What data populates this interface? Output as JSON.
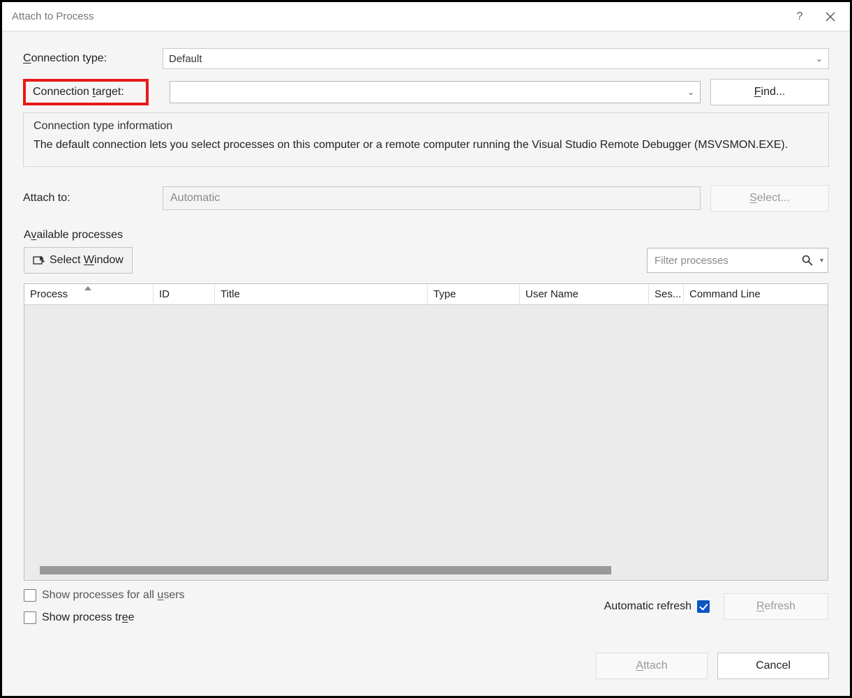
{
  "window": {
    "title": "Attach to Process"
  },
  "labels": {
    "connection_type": "Connection type:",
    "connection_target": "Connection target:",
    "attach_to": "Attach to:",
    "available_processes": "Available processes"
  },
  "fields": {
    "connection_type_value": "Default",
    "connection_target_value": "",
    "attach_to_value": "Automatic",
    "filter_placeholder": "Filter processes"
  },
  "buttons": {
    "find": "Find...",
    "select": "Select...",
    "select_window": "Select Window",
    "refresh": "Refresh",
    "attach": "Attach",
    "cancel": "Cancel"
  },
  "info_group": {
    "title": "Connection type information",
    "text": "The default connection lets you select processes on this computer or a remote computer running the Visual Studio Remote Debugger (MSVSMON.EXE)."
  },
  "columns": {
    "process": "Process",
    "id": "ID",
    "title": "Title",
    "type": "Type",
    "user_name": "User Name",
    "session": "Ses...",
    "command_line": "Command Line"
  },
  "checkboxes": {
    "show_all_users": "Show processes for all users",
    "show_tree": "Show process tree",
    "auto_refresh": "Automatic refresh"
  },
  "state": {
    "show_all_users": false,
    "show_tree": false,
    "auto_refresh": true
  }
}
